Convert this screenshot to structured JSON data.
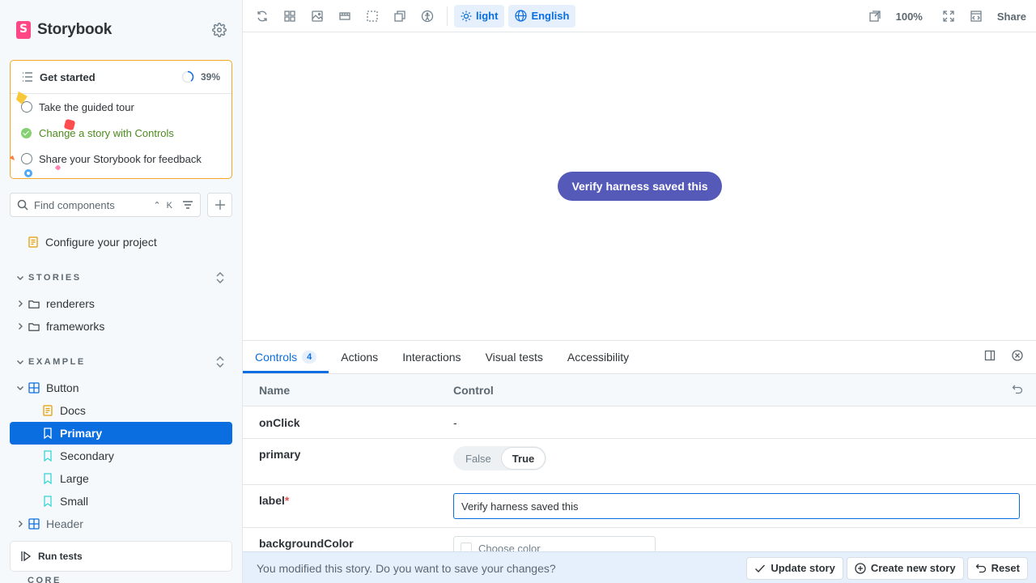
{
  "brand": {
    "name": "Storybook"
  },
  "onboarding": {
    "title": "Get started",
    "progress_percent": 39,
    "progress_label": "39%",
    "tasks": [
      {
        "label": "Take the guided tour",
        "done": false
      },
      {
        "label": "Change a story with Controls",
        "done": true
      },
      {
        "label": "Share your Storybook for feedback",
        "done": false
      }
    ]
  },
  "search": {
    "placeholder": "Find components",
    "shortcut": "⌃ K"
  },
  "tree": {
    "configure": "Configure your project",
    "stories_section": "STORIES",
    "renderers": "renderers",
    "frameworks": "frameworks",
    "example_section": "EXAMPLE",
    "button": "Button",
    "docs": "Docs",
    "primary": "Primary",
    "secondary": "Secondary",
    "large": "Large",
    "small": "Small",
    "header": "Header",
    "core_section": "CORE"
  },
  "run_tests": "Run tests",
  "toolbar": {
    "theme": "light",
    "locale": "English",
    "zoom": "100%",
    "share": "Share"
  },
  "canvas": {
    "button_label": "Verify harness saved this"
  },
  "panel": {
    "tabs": [
      "Controls",
      "Actions",
      "Interactions",
      "Visual tests",
      "Accessibility"
    ],
    "controls_count": "4",
    "head_name": "Name",
    "head_control": "Control",
    "rows": {
      "onclick": {
        "name": "onClick",
        "value": "-"
      },
      "primary": {
        "name": "primary",
        "false_label": "False",
        "true_label": "True",
        "selected": "True"
      },
      "label": {
        "name": "label",
        "required": "*",
        "value": "Verify harness saved this"
      },
      "bg": {
        "name": "backgroundColor",
        "placeholder": "Choose color"
      }
    },
    "save_bar": {
      "message": "You modified this story. Do you want to save your changes?",
      "update": "Update story",
      "create": "Create new story",
      "reset": "Reset"
    }
  },
  "colors": {
    "accent": "#0b6ee0",
    "brand": "#ff4785",
    "story_button": "#555ab9",
    "onboarding_border": "#f5a623"
  }
}
